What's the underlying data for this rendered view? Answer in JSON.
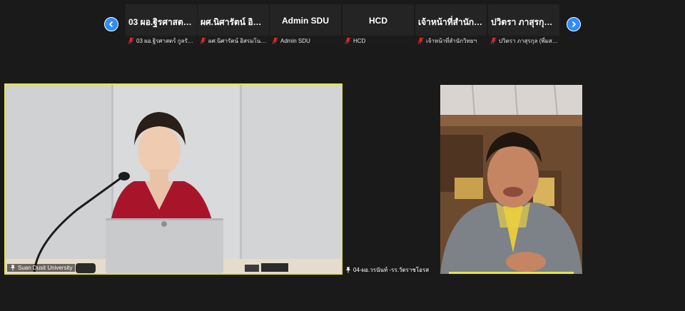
{
  "gallery": {
    "thumbnails": [
      {
        "name": "03 ผอ.ฐิรศาสตร์...",
        "label": "03 ผอ.ฐิรศาสตร์ กูลรัมย์ ..."
      },
      {
        "name": "ผศ.นิศารัตน์ อิสร...",
        "label": "ผศ.นิศารัตน์ อิสรมโนรส-ม.ส..."
      },
      {
        "name": "Admin SDU",
        "label": "Admin SDU"
      },
      {
        "name": "HCD",
        "label": "HCD"
      },
      {
        "name": "เจ้าหน้าที่สำนักวิท...",
        "label": "เจ้าหน้าที่สำนักวิทยฯ"
      },
      {
        "name": "ปวิตรา ภาสุรกุล (...",
        "label": "ปวิตรา ภาสุรกุล (พี่มสรุป)"
      }
    ]
  },
  "main_tiles": {
    "left": {
      "label": "Suan Dusit University"
    },
    "right": {
      "label": "04-ผอ.วรนันท์ -รร.วัดราชโอรส"
    }
  },
  "colors": {
    "active_speaker_border": "#e4e44a",
    "nav_button": "#2d8cff",
    "muted_mic": "#e02828"
  }
}
